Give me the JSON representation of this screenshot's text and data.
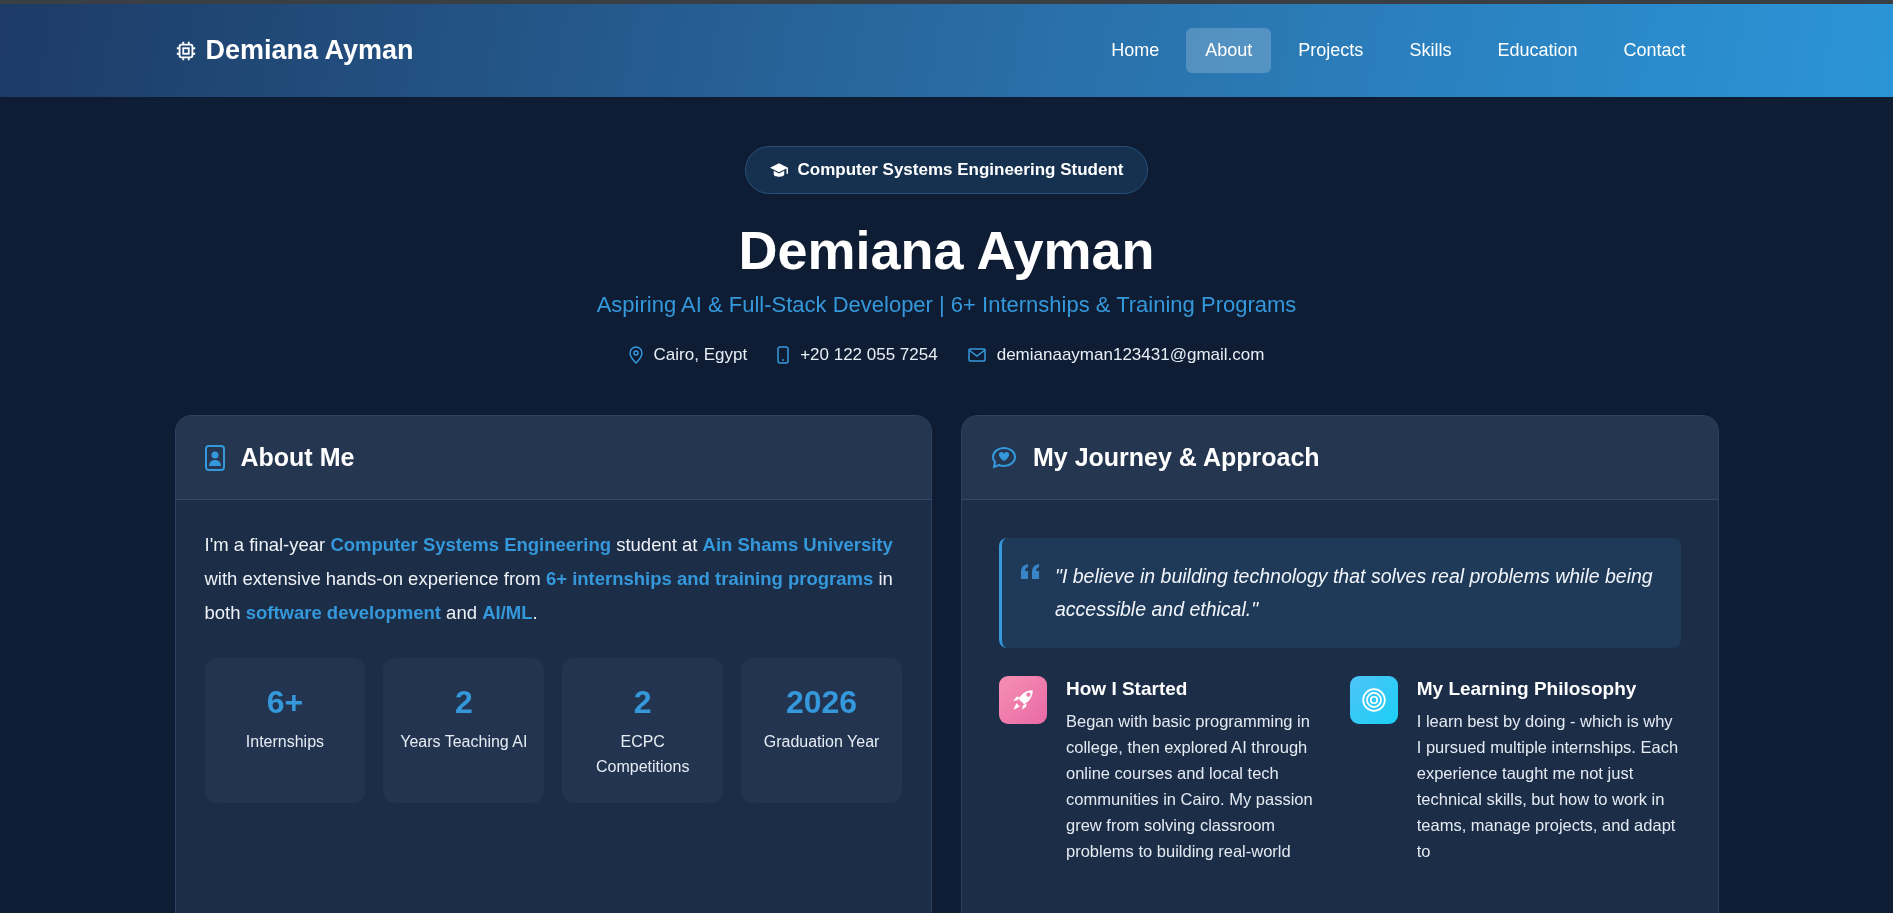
{
  "header": {
    "logo": "Demiana Ayman",
    "nav": [
      {
        "label": "Home",
        "selected": false
      },
      {
        "label": "About",
        "selected": true
      },
      {
        "label": "Projects",
        "selected": false
      },
      {
        "label": "Skills",
        "selected": false
      },
      {
        "label": "Education",
        "selected": false
      },
      {
        "label": "Contact",
        "selected": false
      }
    ]
  },
  "hero": {
    "badge": "Computer Systems Engineering Student",
    "name": "Demiana Ayman",
    "subtitle": "Aspiring AI & Full-Stack Developer | 6+ Internships & Training Programs",
    "contacts": [
      {
        "kind": "location",
        "text": "Cairo, Egypt"
      },
      {
        "kind": "phone",
        "text": "+20 122 055 7254"
      },
      {
        "kind": "email",
        "text": "demianaayman123431@gmail.com"
      }
    ]
  },
  "about": {
    "title": "About Me",
    "paragraph": "I'm a final-year **Computer Systems Engineering** student at **Ain Shams University** with extensive hands-on experience from **6+ internships and training programs** in both **software development** and **AI/ML**.",
    "stats": [
      {
        "value": "6+",
        "label": "Internships"
      },
      {
        "value": "2",
        "label": "Years Teaching AI"
      },
      {
        "value": "2",
        "label": "ECPC Competitions"
      },
      {
        "value": "2026",
        "label": "Graduation Year"
      }
    ]
  },
  "journey": {
    "title": "My Journey & Approach",
    "quote": "\"I believe in building technology that solves real problems while being accessible and ethical.\"",
    "items": [
      {
        "kind": "rocket",
        "title": "How I Started",
        "text": "Began with basic programming in college, then explored AI through online courses and local tech communities in Cairo. My passion grew from solving classroom problems to building real-world"
      },
      {
        "kind": "target",
        "title": "My Learning Philosophy",
        "text": "I learn best by doing - which is why I pursued multiple internships. Each experience taught me not just technical skills, but how to work in teams, manage projects, and adapt to"
      }
    ]
  }
}
